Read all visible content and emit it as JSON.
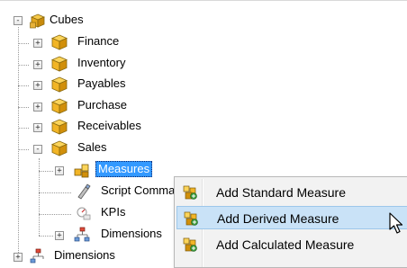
{
  "tree": {
    "root": {
      "label": "Cubes",
      "toggle": "-",
      "icon": "cubes-folder-icon"
    },
    "cubes": [
      {
        "label": "Finance",
        "toggle": "+",
        "icon": "cube-icon"
      },
      {
        "label": "Inventory",
        "toggle": "+",
        "icon": "cube-icon"
      },
      {
        "label": "Payables",
        "toggle": "+",
        "icon": "cube-icon"
      },
      {
        "label": "Purchase",
        "toggle": "+",
        "icon": "cube-icon"
      },
      {
        "label": "Receivables",
        "toggle": "+",
        "icon": "cube-icon"
      },
      {
        "label": "Sales",
        "toggle": "-",
        "icon": "cube-icon"
      }
    ],
    "sales_children": [
      {
        "label": "Measures",
        "toggle": "+",
        "icon": "measures-icon",
        "selected": true
      },
      {
        "label": "Script Comma",
        "icon": "script-commands-icon"
      },
      {
        "label": "KPIs",
        "icon": "kpis-icon"
      },
      {
        "label": "Dimensions",
        "toggle": "+",
        "icon": "dimensions-icon"
      }
    ],
    "bottom": {
      "label": "Dimensions",
      "toggle": "+",
      "icon": "dimensions-icon"
    }
  },
  "context_menu": {
    "items": [
      {
        "label": "Add Standard Measure",
        "icon": "add-measure-icon",
        "highlighted": false
      },
      {
        "label": "Add Derived Measure",
        "icon": "add-measure-icon",
        "highlighted": true
      },
      {
        "label": "Add Calculated Measure",
        "icon": "add-measure-icon",
        "highlighted": false
      }
    ]
  },
  "colors": {
    "selection": "#3399ff",
    "menu_highlight": "#c9e2f7",
    "cube_gold": "#f2b526"
  }
}
